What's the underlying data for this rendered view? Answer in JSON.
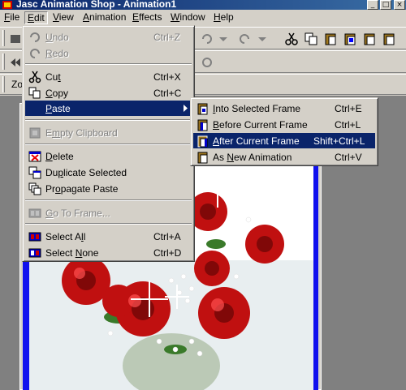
{
  "window": {
    "title": "Jasc Animation Shop - Animation1"
  },
  "menubar": [
    {
      "label": "File",
      "hotkey": "F",
      "rest": "ile"
    },
    {
      "label": "Edit",
      "hotkey": "E",
      "rest": "dit"
    },
    {
      "label": "View",
      "hotkey": "V",
      "rest": "iew"
    },
    {
      "label": "Animation",
      "hotkey": "A",
      "rest": "nimation"
    },
    {
      "label": "Effects",
      "hotkey": "E",
      "rest": "ffects"
    },
    {
      "label": "Window",
      "hotkey": "W",
      "rest": "indow"
    },
    {
      "label": "Help",
      "hotkey": "H",
      "rest": "elp"
    }
  ],
  "toolbar3": {
    "zoom_label": "Zo"
  },
  "edit_menu": {
    "undo": {
      "label": "Undo",
      "pre": "",
      "hot": "U",
      "post": "ndo",
      "shortcut": "Ctrl+Z"
    },
    "redo": {
      "label": "Redo",
      "pre": "",
      "hot": "R",
      "post": "edo",
      "shortcut": ""
    },
    "cut": {
      "label": "Cut",
      "pre": "Cu",
      "hot": "t",
      "post": "",
      "shortcut": "Ctrl+X"
    },
    "copy": {
      "label": "Copy",
      "pre": "",
      "hot": "C",
      "post": "opy",
      "shortcut": "Ctrl+C"
    },
    "paste": {
      "label": "Paste",
      "pre": "",
      "hot": "P",
      "post": "aste"
    },
    "empty_clipboard": {
      "label": "Empty Clipboard",
      "pre": "E",
      "hot": "m",
      "post": "pty Clipboard"
    },
    "delete": {
      "label": "Delete",
      "pre": "",
      "hot": "D",
      "post": "elete"
    },
    "duplicate": {
      "label": "Duplicate Selected",
      "pre": "Du",
      "hot": "p",
      "post": "licate Selected"
    },
    "propagate": {
      "label": "Propagate Paste",
      "pre": "Pr",
      "hot": "o",
      "post": "pagate Paste"
    },
    "goto": {
      "label": "Go To Frame...",
      "pre": "",
      "hot": "G",
      "post": "o To Frame..."
    },
    "select_all": {
      "label": "Select All",
      "pre": "Select A",
      "hot": "l",
      "post": "l",
      "shortcut": "Ctrl+A"
    },
    "select_none": {
      "label": "Select None",
      "pre": "Select ",
      "hot": "N",
      "post": "one",
      "shortcut": "Ctrl+D"
    }
  },
  "paste_submenu": {
    "into_selected": {
      "label": "Into Selected Frame",
      "pre": "",
      "hot": "I",
      "post": "nto Selected Frame",
      "shortcut": "Ctrl+E"
    },
    "before_current": {
      "label": "Before Current Frame",
      "pre": "",
      "hot": "B",
      "post": "efore Current Frame",
      "shortcut": "Ctrl+L"
    },
    "after_current": {
      "label": "After Current Frame",
      "pre": "",
      "hot": "A",
      "post": "fter Current Frame",
      "shortcut": "Shift+Ctrl+L"
    },
    "as_new": {
      "label": "As New Animation",
      "pre": "As ",
      "hot": "N",
      "post": "ew Animation",
      "shortcut": "Ctrl+V"
    }
  },
  "colors": {
    "selection": "#0a246a",
    "face": "#d4d0c8",
    "workspace": "#808080",
    "frame_blue": "#1010ee"
  },
  "icons": [
    "cut-icon",
    "copy-icon",
    "paste-icon",
    "delete-icon",
    "duplicate-icon",
    "propagate-icon",
    "select-all-icon",
    "select-none-icon"
  ]
}
